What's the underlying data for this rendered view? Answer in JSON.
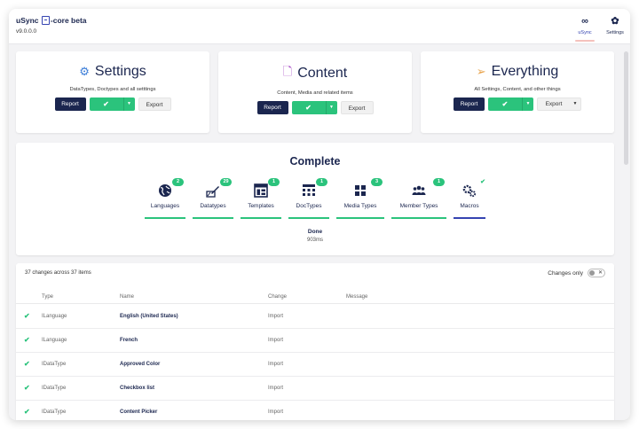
{
  "app": {
    "title_prefix": "uSync",
    "title_suffix": "-core beta",
    "version": "v9.0.0.0"
  },
  "topnav": [
    {
      "label": "uSync",
      "icon": "infinity-icon",
      "glyph": "∞"
    },
    {
      "label": "Settings",
      "icon": "gear-icon",
      "glyph": "✿"
    }
  ],
  "cards": [
    {
      "title": "Settings",
      "icon": "gears-icon",
      "glyph": "⚙",
      "color": "#3b7dd8",
      "description": "DataTypes, Doctypes and all setttings",
      "report": "Report",
      "go": "✔",
      "caret": "▼",
      "export": "Export"
    },
    {
      "title": "Content",
      "icon": "document-icon",
      "glyph": "🗋",
      "color": "#a84cc7",
      "description": "Content, Media and related items",
      "report": "Report",
      "go": "✔",
      "caret": "▼",
      "export": "Export"
    },
    {
      "title": "Everything",
      "icon": "paper-plane-icon",
      "glyph": "➢",
      "color": "#e8a24a",
      "description": "All Settings, Content, and other things",
      "report": "Report",
      "go": "✔",
      "caret": "▼",
      "export": "Export",
      "export_caret": "▼"
    }
  ],
  "status": {
    "title": "Complete",
    "done": "Done",
    "time": "903ms"
  },
  "handlers": [
    {
      "label": "Languages",
      "count": "2",
      "icon": "globe-icon"
    },
    {
      "label": "Datatypes",
      "count": "29",
      "icon": "datatype-icon"
    },
    {
      "label": "Templates",
      "count": "1",
      "icon": "template-icon"
    },
    {
      "label": "DocTypes",
      "count": "1",
      "icon": "doctype-icon"
    },
    {
      "label": "Media Types",
      "count": "3",
      "icon": "media-icon"
    },
    {
      "label": "Member Types",
      "count": "1",
      "icon": "members-icon"
    },
    {
      "label": "Macros",
      "count": "✔",
      "icon": "macro-icon"
    }
  ],
  "results": {
    "summary": "37 changes across 37 items",
    "changes_only_label": "Changes only",
    "toggle_text": "✕",
    "columns": {
      "type": "Type",
      "name": "Name",
      "change": "Change",
      "message": "Message"
    },
    "rows": [
      {
        "type": "ILanguage",
        "name": "English (United States)",
        "change": "Import"
      },
      {
        "type": "ILanguage",
        "name": "French",
        "change": "Import"
      },
      {
        "type": "IDataType",
        "name": "Approved Color",
        "change": "Import"
      },
      {
        "type": "IDataType",
        "name": "Checkbox list",
        "change": "Import"
      },
      {
        "type": "IDataType",
        "name": "Content Picker",
        "change": "Import"
      }
    ],
    "row_check": "✔"
  },
  "colors": {
    "navy": "#1b264f",
    "green": "#2bc37c",
    "accent_blue": "#3544b1"
  }
}
